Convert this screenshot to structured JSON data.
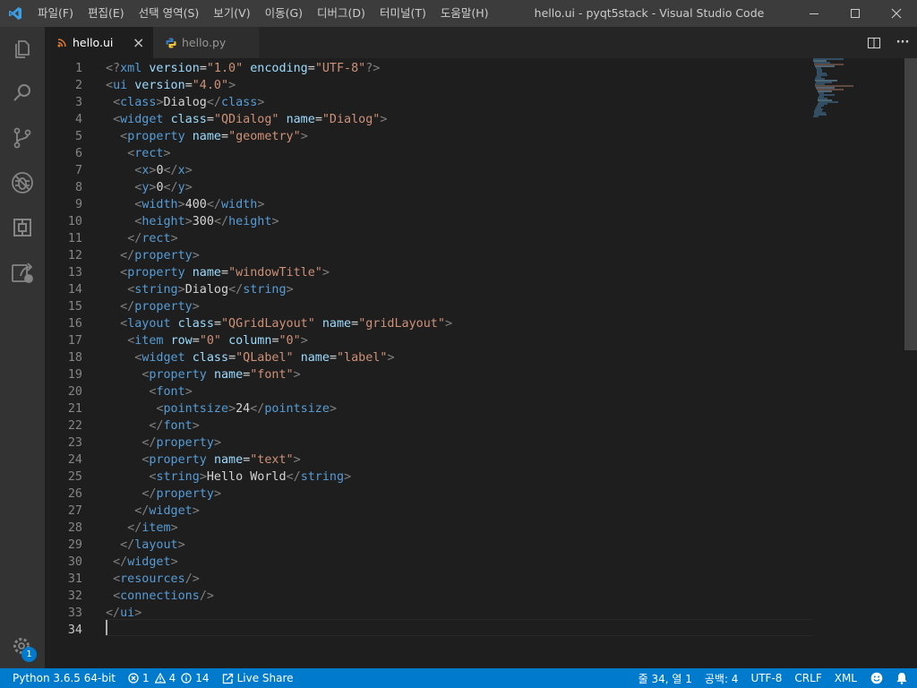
{
  "window": {
    "title": "hello.ui - pyqt5stack - Visual Studio Code",
    "menu": [
      "파일(F)",
      "편집(E)",
      "선택 영역(S)",
      "보기(V)",
      "이동(G)",
      "디버그(D)",
      "터미널(T)",
      "도움말(H)"
    ]
  },
  "activity_bar": {
    "items": [
      "explorer-icon",
      "search-icon",
      "source-control-icon",
      "debug-icon",
      "extensions-icon",
      "remote-explorer-icon"
    ],
    "manage_badge": "1"
  },
  "tabs": [
    {
      "label": "hello.ui",
      "icon": "rss-icon",
      "active": true,
      "close": "×"
    },
    {
      "label": "hello.py",
      "icon": "python-icon",
      "active": false
    }
  ],
  "tab_actions": {
    "split": "split-editor-icon",
    "more": "···"
  },
  "editor": {
    "current_line": 34,
    "lines": [
      [
        {
          "t": "punc",
          "s": "<?"
        },
        {
          "t": "tag",
          "s": "xml"
        },
        {
          "t": "text",
          "s": " "
        },
        {
          "t": "attr",
          "s": "version"
        },
        {
          "t": "text",
          "s": "="
        },
        {
          "t": "str",
          "s": "\"1.0\""
        },
        {
          "t": "text",
          "s": " "
        },
        {
          "t": "attr",
          "s": "encoding"
        },
        {
          "t": "text",
          "s": "="
        },
        {
          "t": "str",
          "s": "\"UTF-8\""
        },
        {
          "t": "punc",
          "s": "?>"
        }
      ],
      [
        {
          "t": "punc",
          "s": "<"
        },
        {
          "t": "tag",
          "s": "ui"
        },
        {
          "t": "text",
          "s": " "
        },
        {
          "t": "attr",
          "s": "version"
        },
        {
          "t": "text",
          "s": "="
        },
        {
          "t": "str",
          "s": "\"4.0\""
        },
        {
          "t": "punc",
          "s": ">"
        }
      ],
      [
        {
          "t": "text",
          "s": " "
        },
        {
          "t": "punc",
          "s": "<"
        },
        {
          "t": "tag",
          "s": "class"
        },
        {
          "t": "punc",
          "s": ">"
        },
        {
          "t": "text",
          "s": "Dialog"
        },
        {
          "t": "punc",
          "s": "</"
        },
        {
          "t": "tag",
          "s": "class"
        },
        {
          "t": "punc",
          "s": ">"
        }
      ],
      [
        {
          "t": "text",
          "s": " "
        },
        {
          "t": "punc",
          "s": "<"
        },
        {
          "t": "tag",
          "s": "widget"
        },
        {
          "t": "text",
          "s": " "
        },
        {
          "t": "attr",
          "s": "class"
        },
        {
          "t": "text",
          "s": "="
        },
        {
          "t": "str",
          "s": "\"QDialog\""
        },
        {
          "t": "text",
          "s": " "
        },
        {
          "t": "attr",
          "s": "name"
        },
        {
          "t": "text",
          "s": "="
        },
        {
          "t": "str",
          "s": "\"Dialog\""
        },
        {
          "t": "punc",
          "s": ">"
        }
      ],
      [
        {
          "t": "text",
          "s": "  "
        },
        {
          "t": "punc",
          "s": "<"
        },
        {
          "t": "tag",
          "s": "property"
        },
        {
          "t": "text",
          "s": " "
        },
        {
          "t": "attr",
          "s": "name"
        },
        {
          "t": "text",
          "s": "="
        },
        {
          "t": "str",
          "s": "\"geometry\""
        },
        {
          "t": "punc",
          "s": ">"
        }
      ],
      [
        {
          "t": "text",
          "s": "   "
        },
        {
          "t": "punc",
          "s": "<"
        },
        {
          "t": "tag",
          "s": "rect"
        },
        {
          "t": "punc",
          "s": ">"
        }
      ],
      [
        {
          "t": "text",
          "s": "    "
        },
        {
          "t": "punc",
          "s": "<"
        },
        {
          "t": "tag",
          "s": "x"
        },
        {
          "t": "punc",
          "s": ">"
        },
        {
          "t": "text",
          "s": "0"
        },
        {
          "t": "punc",
          "s": "</"
        },
        {
          "t": "tag",
          "s": "x"
        },
        {
          "t": "punc",
          "s": ">"
        }
      ],
      [
        {
          "t": "text",
          "s": "    "
        },
        {
          "t": "punc",
          "s": "<"
        },
        {
          "t": "tag",
          "s": "y"
        },
        {
          "t": "punc",
          "s": ">"
        },
        {
          "t": "text",
          "s": "0"
        },
        {
          "t": "punc",
          "s": "</"
        },
        {
          "t": "tag",
          "s": "y"
        },
        {
          "t": "punc",
          "s": ">"
        }
      ],
      [
        {
          "t": "text",
          "s": "    "
        },
        {
          "t": "punc",
          "s": "<"
        },
        {
          "t": "tag",
          "s": "width"
        },
        {
          "t": "punc",
          "s": ">"
        },
        {
          "t": "text",
          "s": "400"
        },
        {
          "t": "punc",
          "s": "</"
        },
        {
          "t": "tag",
          "s": "width"
        },
        {
          "t": "punc",
          "s": ">"
        }
      ],
      [
        {
          "t": "text",
          "s": "    "
        },
        {
          "t": "punc",
          "s": "<"
        },
        {
          "t": "tag",
          "s": "height"
        },
        {
          "t": "punc",
          "s": ">"
        },
        {
          "t": "text",
          "s": "300"
        },
        {
          "t": "punc",
          "s": "</"
        },
        {
          "t": "tag",
          "s": "height"
        },
        {
          "t": "punc",
          "s": ">"
        }
      ],
      [
        {
          "t": "text",
          "s": "   "
        },
        {
          "t": "punc",
          "s": "</"
        },
        {
          "t": "tag",
          "s": "rect"
        },
        {
          "t": "punc",
          "s": ">"
        }
      ],
      [
        {
          "t": "text",
          "s": "  "
        },
        {
          "t": "punc",
          "s": "</"
        },
        {
          "t": "tag",
          "s": "property"
        },
        {
          "t": "punc",
          "s": ">"
        }
      ],
      [
        {
          "t": "text",
          "s": "  "
        },
        {
          "t": "punc",
          "s": "<"
        },
        {
          "t": "tag",
          "s": "property"
        },
        {
          "t": "text",
          "s": " "
        },
        {
          "t": "attr",
          "s": "name"
        },
        {
          "t": "text",
          "s": "="
        },
        {
          "t": "str",
          "s": "\"windowTitle\""
        },
        {
          "t": "punc",
          "s": ">"
        }
      ],
      [
        {
          "t": "text",
          "s": "   "
        },
        {
          "t": "punc",
          "s": "<"
        },
        {
          "t": "tag",
          "s": "string"
        },
        {
          "t": "punc",
          "s": ">"
        },
        {
          "t": "text",
          "s": "Dialog"
        },
        {
          "t": "punc",
          "s": "</"
        },
        {
          "t": "tag",
          "s": "string"
        },
        {
          "t": "punc",
          "s": ">"
        }
      ],
      [
        {
          "t": "text",
          "s": "  "
        },
        {
          "t": "punc",
          "s": "</"
        },
        {
          "t": "tag",
          "s": "property"
        },
        {
          "t": "punc",
          "s": ">"
        }
      ],
      [
        {
          "t": "text",
          "s": "  "
        },
        {
          "t": "punc",
          "s": "<"
        },
        {
          "t": "tag",
          "s": "layout"
        },
        {
          "t": "text",
          "s": " "
        },
        {
          "t": "attr",
          "s": "class"
        },
        {
          "t": "text",
          "s": "="
        },
        {
          "t": "str",
          "s": "\"QGridLayout\""
        },
        {
          "t": "text",
          "s": " "
        },
        {
          "t": "attr",
          "s": "name"
        },
        {
          "t": "text",
          "s": "="
        },
        {
          "t": "str",
          "s": "\"gridLayout\""
        },
        {
          "t": "punc",
          "s": ">"
        }
      ],
      [
        {
          "t": "text",
          "s": "   "
        },
        {
          "t": "punc",
          "s": "<"
        },
        {
          "t": "tag",
          "s": "item"
        },
        {
          "t": "text",
          "s": " "
        },
        {
          "t": "attr",
          "s": "row"
        },
        {
          "t": "text",
          "s": "="
        },
        {
          "t": "str",
          "s": "\"0\""
        },
        {
          "t": "text",
          "s": " "
        },
        {
          "t": "attr",
          "s": "column"
        },
        {
          "t": "text",
          "s": "="
        },
        {
          "t": "str",
          "s": "\"0\""
        },
        {
          "t": "punc",
          "s": ">"
        }
      ],
      [
        {
          "t": "text",
          "s": "    "
        },
        {
          "t": "punc",
          "s": "<"
        },
        {
          "t": "tag",
          "s": "widget"
        },
        {
          "t": "text",
          "s": " "
        },
        {
          "t": "attr",
          "s": "class"
        },
        {
          "t": "text",
          "s": "="
        },
        {
          "t": "str",
          "s": "\"QLabel\""
        },
        {
          "t": "text",
          "s": " "
        },
        {
          "t": "attr",
          "s": "name"
        },
        {
          "t": "text",
          "s": "="
        },
        {
          "t": "str",
          "s": "\"label\""
        },
        {
          "t": "punc",
          "s": ">"
        }
      ],
      [
        {
          "t": "text",
          "s": "     "
        },
        {
          "t": "punc",
          "s": "<"
        },
        {
          "t": "tag",
          "s": "property"
        },
        {
          "t": "text",
          "s": " "
        },
        {
          "t": "attr",
          "s": "name"
        },
        {
          "t": "text",
          "s": "="
        },
        {
          "t": "str",
          "s": "\"font\""
        },
        {
          "t": "punc",
          "s": ">"
        }
      ],
      [
        {
          "t": "text",
          "s": "      "
        },
        {
          "t": "punc",
          "s": "<"
        },
        {
          "t": "tag",
          "s": "font"
        },
        {
          "t": "punc",
          "s": ">"
        }
      ],
      [
        {
          "t": "text",
          "s": "       "
        },
        {
          "t": "punc",
          "s": "<"
        },
        {
          "t": "tag",
          "s": "pointsize"
        },
        {
          "t": "punc",
          "s": ">"
        },
        {
          "t": "text",
          "s": "24"
        },
        {
          "t": "punc",
          "s": "</"
        },
        {
          "t": "tag",
          "s": "pointsize"
        },
        {
          "t": "punc",
          "s": ">"
        }
      ],
      [
        {
          "t": "text",
          "s": "      "
        },
        {
          "t": "punc",
          "s": "</"
        },
        {
          "t": "tag",
          "s": "font"
        },
        {
          "t": "punc",
          "s": ">"
        }
      ],
      [
        {
          "t": "text",
          "s": "     "
        },
        {
          "t": "punc",
          "s": "</"
        },
        {
          "t": "tag",
          "s": "property"
        },
        {
          "t": "punc",
          "s": ">"
        }
      ],
      [
        {
          "t": "text",
          "s": "     "
        },
        {
          "t": "punc",
          "s": "<"
        },
        {
          "t": "tag",
          "s": "property"
        },
        {
          "t": "text",
          "s": " "
        },
        {
          "t": "attr",
          "s": "name"
        },
        {
          "t": "text",
          "s": "="
        },
        {
          "t": "str",
          "s": "\"text\""
        },
        {
          "t": "punc",
          "s": ">"
        }
      ],
      [
        {
          "t": "text",
          "s": "      "
        },
        {
          "t": "punc",
          "s": "<"
        },
        {
          "t": "tag",
          "s": "string"
        },
        {
          "t": "punc",
          "s": ">"
        },
        {
          "t": "text",
          "s": "Hello World"
        },
        {
          "t": "punc",
          "s": "</"
        },
        {
          "t": "tag",
          "s": "string"
        },
        {
          "t": "punc",
          "s": ">"
        }
      ],
      [
        {
          "t": "text",
          "s": "     "
        },
        {
          "t": "punc",
          "s": "</"
        },
        {
          "t": "tag",
          "s": "property"
        },
        {
          "t": "punc",
          "s": ">"
        }
      ],
      [
        {
          "t": "text",
          "s": "    "
        },
        {
          "t": "punc",
          "s": "</"
        },
        {
          "t": "tag",
          "s": "widget"
        },
        {
          "t": "punc",
          "s": ">"
        }
      ],
      [
        {
          "t": "text",
          "s": "   "
        },
        {
          "t": "punc",
          "s": "</"
        },
        {
          "t": "tag",
          "s": "item"
        },
        {
          "t": "punc",
          "s": ">"
        }
      ],
      [
        {
          "t": "text",
          "s": "  "
        },
        {
          "t": "punc",
          "s": "</"
        },
        {
          "t": "tag",
          "s": "layout"
        },
        {
          "t": "punc",
          "s": ">"
        }
      ],
      [
        {
          "t": "text",
          "s": " "
        },
        {
          "t": "punc",
          "s": "</"
        },
        {
          "t": "tag",
          "s": "widget"
        },
        {
          "t": "punc",
          "s": ">"
        }
      ],
      [
        {
          "t": "text",
          "s": " "
        },
        {
          "t": "punc",
          "s": "<"
        },
        {
          "t": "tag",
          "s": "resources"
        },
        {
          "t": "punc",
          "s": "/>"
        }
      ],
      [
        {
          "t": "text",
          "s": " "
        },
        {
          "t": "punc",
          "s": "<"
        },
        {
          "t": "tag",
          "s": "connections"
        },
        {
          "t": "punc",
          "s": "/>"
        }
      ],
      [
        {
          "t": "punc",
          "s": "</"
        },
        {
          "t": "tag",
          "s": "ui"
        },
        {
          "t": "punc",
          "s": ">"
        }
      ],
      []
    ]
  },
  "status_bar": {
    "python": "Python 3.6.5 64-bit",
    "errors": "1",
    "warnings": "4",
    "infos": "14",
    "live_share": "Live Share",
    "position": "줄 34, 열 1",
    "indent": "공백: 4",
    "encoding": "UTF-8",
    "eol": "CRLF",
    "language": "XML"
  },
  "colors": {
    "accent": "#007acc",
    "tag": "#569cd6",
    "attr": "#9cdcfe",
    "string": "#ce9178",
    "punctuation": "#808080",
    "text": "#d4d4d4"
  }
}
